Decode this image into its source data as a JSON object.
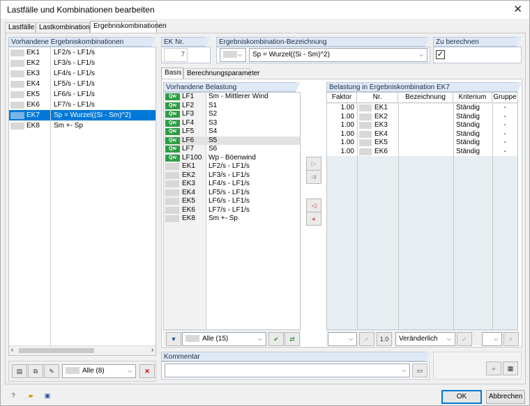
{
  "window": {
    "title": "Lastfälle und Kombinationen bearbeiten",
    "close_glyph": "✕"
  },
  "tabs": [
    "Lastfälle",
    "Lastkombinationen",
    "Ergebniskombinationen"
  ],
  "left": {
    "header": "Vorhandene Ergebniskombinationen",
    "items": [
      {
        "id": "EK1",
        "desc": "LF2/s - LF1/s"
      },
      {
        "id": "EK2",
        "desc": "LF3/s - LF1/s"
      },
      {
        "id": "EK3",
        "desc": "LF4/s - LF1/s"
      },
      {
        "id": "EK4",
        "desc": "LF5/s - LF1/s"
      },
      {
        "id": "EK5",
        "desc": "LF6/s - LF1/s"
      },
      {
        "id": "EK6",
        "desc": "LF7/s - LF1/s"
      },
      {
        "id": "EK7",
        "desc": "Sp = Wurzel((Si - Sm)^2)"
      },
      {
        "id": "EK8",
        "desc": "Sm +- Sp"
      }
    ],
    "filter": "Alle (8)"
  },
  "top": {
    "ek_nr_label": "EK Nr.",
    "ek_nr_value": "7",
    "bez_label": "Ergebniskombination-Bezeichnung",
    "bez_value": "Sp = Wurzel((Si - Sm)^2)",
    "zu_label": "Zu berechnen"
  },
  "subtabs": [
    "Basis",
    "Berechnungsparameter"
  ],
  "vorhandene": {
    "header": "Vorhandene Belastung",
    "items": [
      {
        "badge": "Qw",
        "id": "LF1",
        "desc": "Sm - Mittlerer Wind"
      },
      {
        "badge": "Qw",
        "id": "LF2",
        "desc": "S1"
      },
      {
        "badge": "Qw",
        "id": "LF3",
        "desc": "S2"
      },
      {
        "badge": "Qw",
        "id": "LF4",
        "desc": "S3"
      },
      {
        "badge": "Qw",
        "id": "LF5",
        "desc": "S4"
      },
      {
        "badge": "Qw",
        "id": "LF6",
        "desc": "S5"
      },
      {
        "badge": "Qw",
        "id": "LF7",
        "desc": "S6"
      },
      {
        "badge": "Qw",
        "id": "LF100",
        "desc": "Wp - Böenwind"
      },
      {
        "badge": "",
        "id": "EK1",
        "desc": "LF2/s - LF1/s"
      },
      {
        "badge": "",
        "id": "EK2",
        "desc": "LF3/s - LF1/s"
      },
      {
        "badge": "",
        "id": "EK3",
        "desc": "LF4/s - LF1/s"
      },
      {
        "badge": "",
        "id": "EK4",
        "desc": "LF5/s - LF1/s"
      },
      {
        "badge": "",
        "id": "EK5",
        "desc": "LF6/s - LF1/s"
      },
      {
        "badge": "",
        "id": "EK6",
        "desc": "LF7/s - LF1/s"
      },
      {
        "badge": "",
        "id": "EK8",
        "desc": "Sm +- Sp"
      }
    ],
    "filter": "Alle (15)"
  },
  "belastung": {
    "header": "Belastung in Ergebniskombination EK7",
    "columns": [
      "Faktor",
      "Nr.",
      "Bezeichnung",
      "Kriterium",
      "Gruppe"
    ],
    "rows": [
      {
        "faktor": "1.00",
        "nr": "EK1",
        "bez": "",
        "krit": "Ständig",
        "gruppe": "-"
      },
      {
        "faktor": "1.00",
        "nr": "EK2",
        "bez": "",
        "krit": "Ständig",
        "gruppe": "-"
      },
      {
        "faktor": "1.00",
        "nr": "EK3",
        "bez": "",
        "krit": "Ständig",
        "gruppe": "-"
      },
      {
        "faktor": "1.00",
        "nr": "EK4",
        "bez": "",
        "krit": "Ständig",
        "gruppe": "-"
      },
      {
        "faktor": "1.00",
        "nr": "EK5",
        "bez": "",
        "krit": "Ständig",
        "gruppe": "-"
      },
      {
        "faktor": "1.00",
        "nr": "EK6",
        "bez": "",
        "krit": "Ständig",
        "gruppe": "-"
      }
    ],
    "factor_btn": "1.0",
    "kriterium": "Veränderlich"
  },
  "kommentar": {
    "label": "Kommentar",
    "value": ""
  },
  "footer": {
    "ok": "OK",
    "cancel": "Abbrechen"
  }
}
